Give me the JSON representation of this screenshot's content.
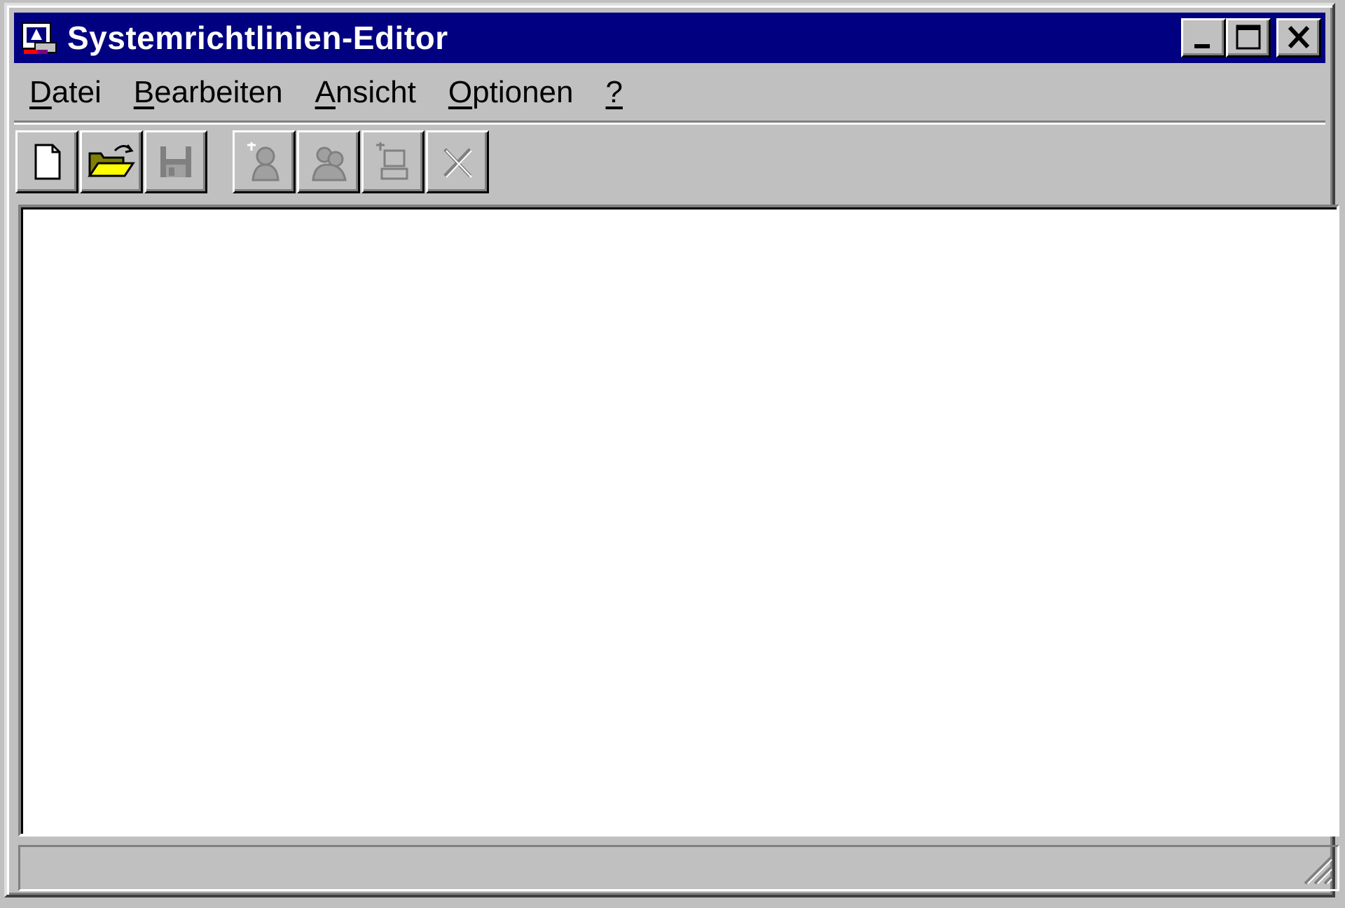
{
  "window": {
    "title": "Systemrichtlinien-Editor",
    "controls": [
      "minimize",
      "maximize",
      "close"
    ]
  },
  "menu": [
    {
      "label": "Datei",
      "accel": "D",
      "rest": "atei"
    },
    {
      "label": "Bearbeiten",
      "accel": "B",
      "rest": "earbeiten"
    },
    {
      "label": "Ansicht",
      "accel": "A",
      "rest": "nsicht"
    },
    {
      "label": "Optionen",
      "accel": "O",
      "rest": "ptionen"
    },
    {
      "label": "?",
      "accel": "?",
      "rest": ""
    }
  ],
  "toolbar": [
    {
      "name": "new",
      "icon": "new-document-icon",
      "enabled": true
    },
    {
      "name": "open",
      "icon": "open-folder-icon",
      "enabled": true
    },
    {
      "name": "save",
      "icon": "save-disk-icon",
      "enabled": false
    },
    {
      "name": "add-user",
      "icon": "add-user-icon",
      "enabled": false
    },
    {
      "name": "add-group",
      "icon": "add-group-icon",
      "enabled": false
    },
    {
      "name": "add-computer",
      "icon": "add-computer-icon",
      "enabled": false
    },
    {
      "name": "remove",
      "icon": "remove-x-icon",
      "enabled": false
    }
  ],
  "colors": {
    "titlebar": "#000080",
    "face": "#c0c0c0",
    "content": "#ffffff",
    "disabled": "#808080"
  }
}
